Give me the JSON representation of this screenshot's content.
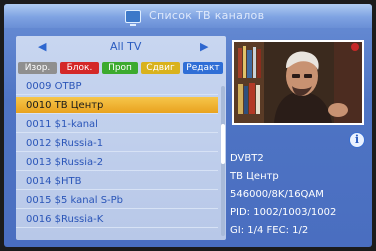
{
  "title": "Список ТВ каналов",
  "list_name": "All TV",
  "color_buttons": [
    {
      "label": "Изор.",
      "color": "#8f8f8f"
    },
    {
      "label": "Блок.",
      "color": "#d42828"
    },
    {
      "label": "Проп",
      "color": "#3caa2e"
    },
    {
      "label": "Сдвиг",
      "color": "#d9b21c"
    },
    {
      "label": "Редакт",
      "color": "#2f6ed6"
    }
  ],
  "channels": [
    {
      "label": "0009 OTBP"
    },
    {
      "label": "0010 ТВ Центр"
    },
    {
      "label": "0011 $1-kanal"
    },
    {
      "label": "0012 $Russia-1"
    },
    {
      "label": "0013 $Russia-2"
    },
    {
      "label": "0014 $HTB"
    },
    {
      "label": "0015 $5 kanal S-Pb"
    },
    {
      "label": "0016 $Russia-K"
    }
  ],
  "selected_channel": "0010 ТВ Центр",
  "info": {
    "standard": "DVBT2",
    "channel": "ТВ Центр",
    "frequency": "546000/8K/16QAM",
    "pid": "PID: 1002/1003/1002",
    "gi_fec": "GI: 1/4   FEC: 1/2"
  },
  "icons": {
    "title": "tv-icon",
    "nav_left": "triangle-left-icon",
    "nav_right": "triangle-right-icon",
    "info": "info-icon"
  },
  "colors": {
    "accent_selected": "#f2b63a",
    "panel_bg": "#c8d6f0",
    "text_blue": "#2a55b8"
  }
}
